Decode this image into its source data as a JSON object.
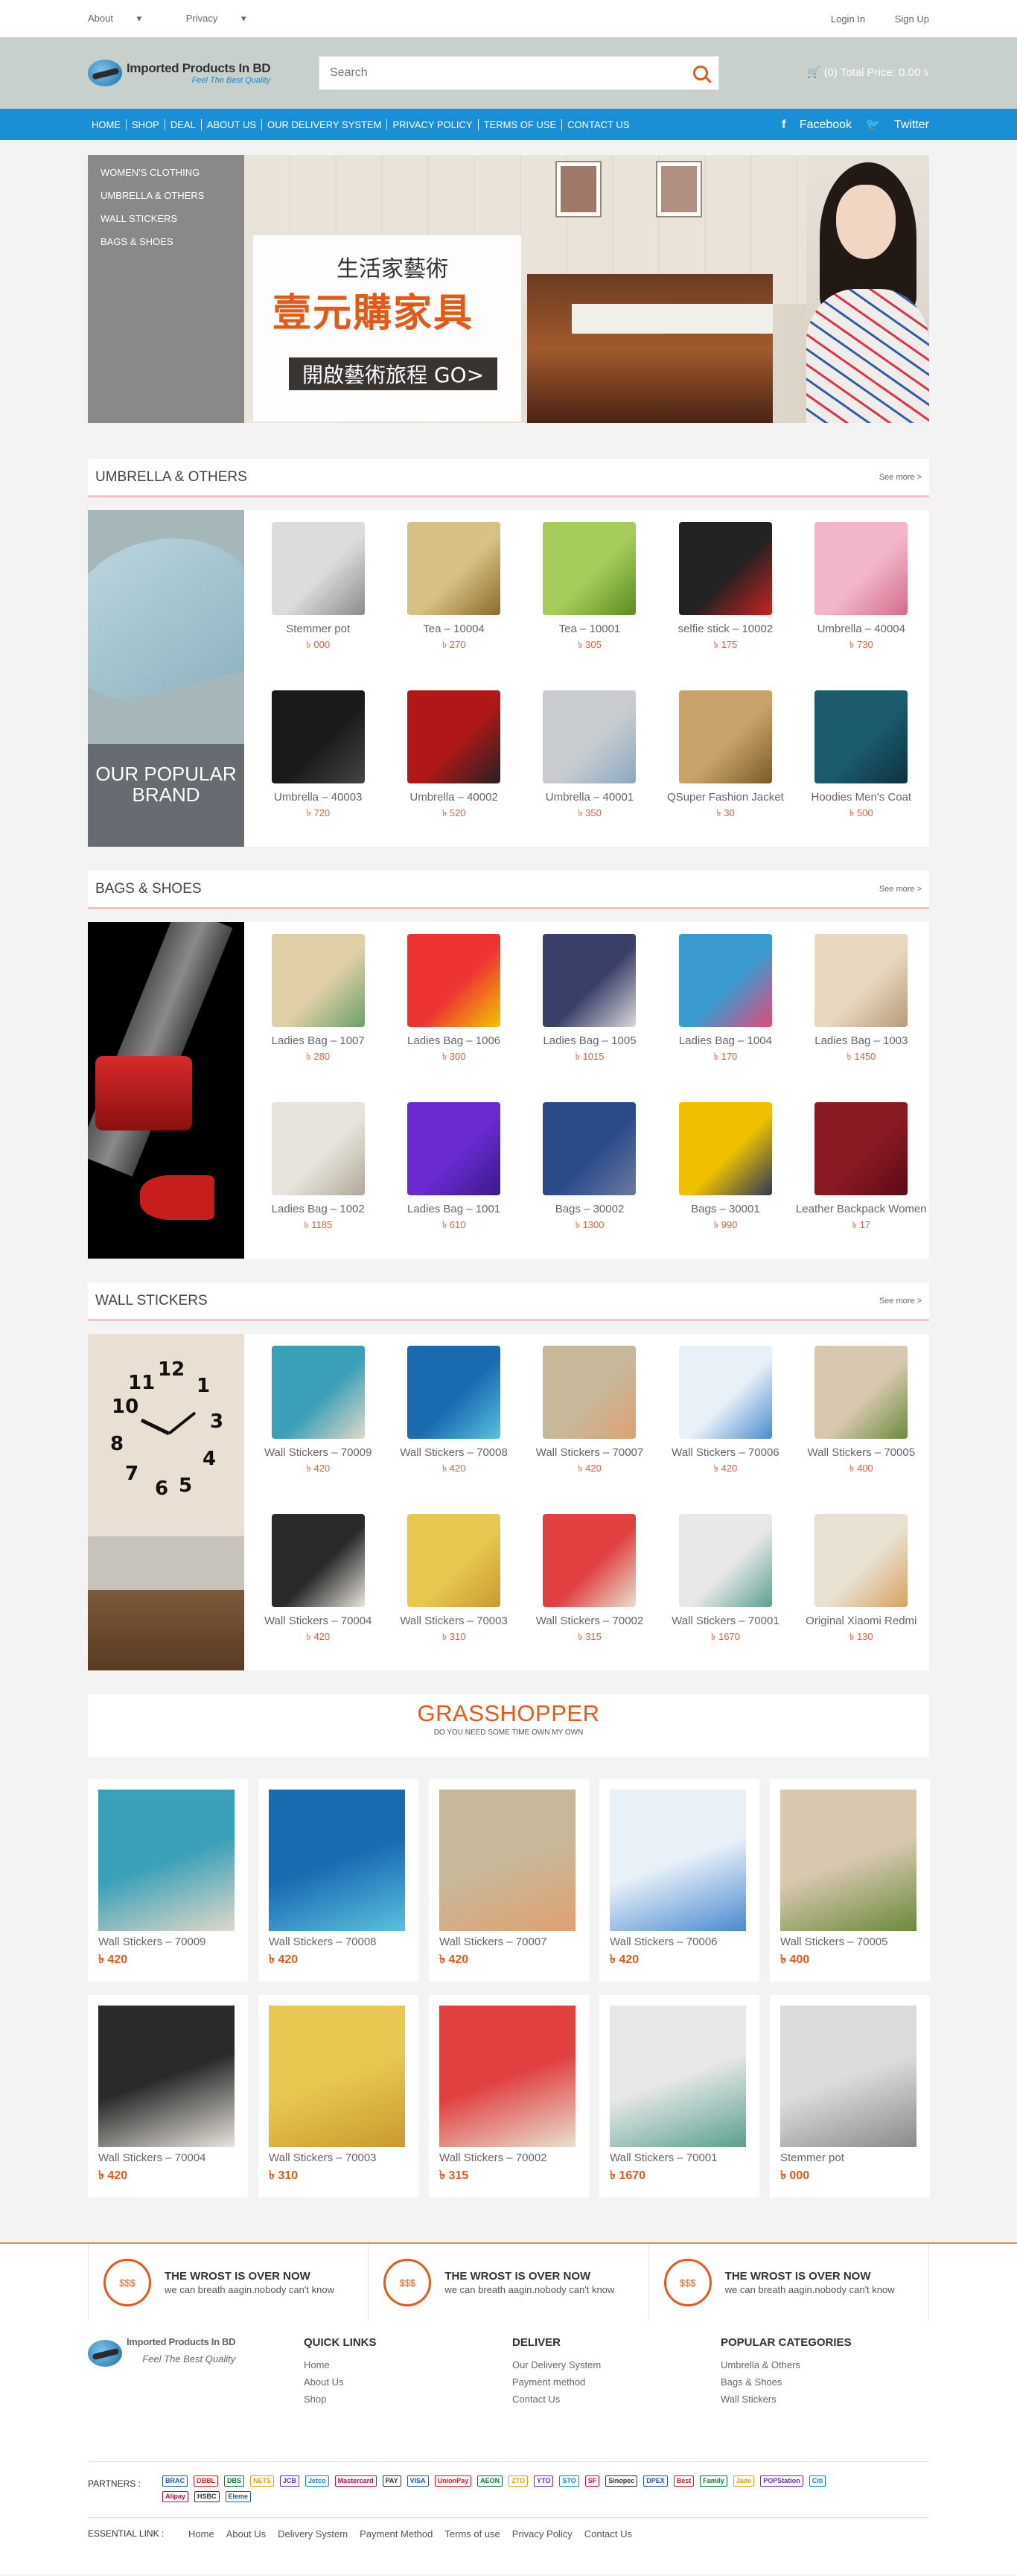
{
  "topbar": {
    "about": "About",
    "privacy": "Privacy",
    "login": "Login In",
    "signup": "Sign Up"
  },
  "header": {
    "logo_title": "Imported Products In BD",
    "logo_tagline": "Feel The Best Quality",
    "search_placeholder": "Search",
    "cart": "(0) Total Price: 0.00 ৳"
  },
  "nav": {
    "items": [
      "HOME",
      "SHOP",
      "DEAL",
      "ABOUT US",
      "OUR DELIVERY SYSTEM",
      "PRIVACY POLICY",
      "TERMS OF USE",
      "CONTACT US"
    ],
    "facebook": "Facebook",
    "twitter": "Twitter"
  },
  "sidebar": {
    "categories": [
      "WOMEN'S CLOTHING",
      "UMBRELLA & OTHERS",
      "WALL STICKERS",
      "BAGS & SHOES"
    ]
  },
  "banner": {
    "line1": "生活家藝術",
    "line2": "壹元購家具",
    "cta": "開啟藝術旅程 GO>"
  },
  "sections": [
    {
      "title": "UMBRELLA & OTHERS",
      "see_more": "See more >",
      "promo_label": "OUR POPULAR BRAND",
      "items": [
        {
          "name": "Stemmer pot",
          "price": "৳ 000"
        },
        {
          "name": "Tea – 10004",
          "price": "৳ 270"
        },
        {
          "name": "Tea – 10001",
          "price": "৳ 305"
        },
        {
          "name": "selfie stick – 10002",
          "price": "৳ 175"
        },
        {
          "name": "Umbrella – 40004",
          "price": "৳ 730"
        },
        {
          "name": "Umbrella – 40003",
          "price": "৳ 720"
        },
        {
          "name": "Umbrella – 40002",
          "price": "৳ 520"
        },
        {
          "name": "Umbrella – 40001",
          "price": "৳ 350"
        },
        {
          "name": "QSuper Fashion Jacket",
          "price": "৳ 30"
        },
        {
          "name": "Hoodies Men's Coat",
          "price": "৳ 500"
        }
      ]
    },
    {
      "title": "BAGS & SHOES",
      "see_more": "See more >",
      "items": [
        {
          "name": "Ladies Bag – 1007",
          "price": "৳ 280"
        },
        {
          "name": "Ladies Bag – 1006",
          "price": "৳ 300"
        },
        {
          "name": "Ladies Bag – 1005",
          "price": "৳ 1015"
        },
        {
          "name": "Ladies Bag – 1004",
          "price": "৳ 170"
        },
        {
          "name": "Ladies Bag – 1003",
          "price": "৳ 1450"
        },
        {
          "name": "Ladies Bag – 1002",
          "price": "৳ 1185"
        },
        {
          "name": "Ladies Bag – 1001",
          "price": "৳ 610"
        },
        {
          "name": "Bags – 30002",
          "price": "৳ 1300"
        },
        {
          "name": "Bags – 30001",
          "price": "৳ 990"
        },
        {
          "name": "Leather Backpack Women",
          "price": "৳ 17"
        }
      ]
    },
    {
      "title": "WALL STICKERS",
      "see_more": "See more >",
      "items": [
        {
          "name": "Wall Stickers – 70009",
          "price": "৳ 420"
        },
        {
          "name": "Wall Stickers – 70008",
          "price": "৳ 420"
        },
        {
          "name": "Wall Stickers – 70007",
          "price": "৳ 420"
        },
        {
          "name": "Wall Stickers – 70006",
          "price": "৳ 420"
        },
        {
          "name": "Wall Stickers – 70005",
          "price": "৳ 400"
        },
        {
          "name": "Wall Stickers – 70004",
          "price": "৳ 420"
        },
        {
          "name": "Wall Stickers – 70003",
          "price": "৳ 310"
        },
        {
          "name": "Wall Stickers – 70002",
          "price": "৳ 315"
        },
        {
          "name": "Wall Stickers – 70001",
          "price": "৳ 1670"
        },
        {
          "name": "Original Xiaomi Redmi",
          "price": "৳ 130"
        }
      ]
    }
  ],
  "grasshopper": {
    "title": "GRASSHOPPER",
    "subtitle": "DO YOU NEED SOME TIME OWN MY OWN",
    "cards": [
      {
        "name": "Wall Stickers – 70009",
        "price": "৳ 420"
      },
      {
        "name": "Wall Stickers – 70008",
        "price": "৳ 420"
      },
      {
        "name": "Wall Stickers – 70007",
        "price": "৳ 420"
      },
      {
        "name": "Wall Stickers – 70006",
        "price": "৳ 420"
      },
      {
        "name": "Wall Stickers – 70005",
        "price": "৳ 400"
      },
      {
        "name": "Wall Stickers – 70004",
        "price": "৳ 420"
      },
      {
        "name": "Wall Stickers – 70003",
        "price": "৳ 310"
      },
      {
        "name": "Wall Stickers – 70002",
        "price": "৳ 315"
      },
      {
        "name": "Wall Stickers – 70001",
        "price": "৳ 1670"
      },
      {
        "name": "Stemmer pot",
        "price": "৳ 000"
      }
    ]
  },
  "features": [
    {
      "icon": "$$$",
      "title": "THE WROST IS OVER NOW",
      "text": "we can breath aagin.nobody can't know"
    },
    {
      "icon": "$$$",
      "title": "THE WROST IS OVER NOW",
      "text": "we can breath aagin.nobody can't know"
    },
    {
      "icon": "$$$",
      "title": "THE WROST IS OVER NOW",
      "text": "we can breath aagin.nobody can't know"
    }
  ],
  "footer": {
    "quick_links": {
      "title": "QUICK LINKS",
      "items": [
        "Home",
        "About Us",
        "Shop"
      ]
    },
    "deliver": {
      "title": "DELIVER",
      "items": [
        "Our Delivery System",
        "Payment method",
        "Contact Us"
      ]
    },
    "popular": {
      "title": "POPULAR CATEGORIES",
      "items": [
        "Umbrella & Others",
        "Bags & Shoes",
        "Wall Stickers"
      ]
    },
    "partners_label": "PARTNERS :",
    "partners": [
      "BRAC",
      "DBBL",
      "DBS",
      "NETS",
      "JCB",
      "Jetco",
      "Mastercard",
      "PAY",
      "VISA",
      "UnionPay",
      "AEON",
      "ZTO",
      "YTO",
      "STO",
      "SF",
      "Sinopec",
      "DPEX",
      "Best",
      "Family",
      "Jade",
      "POPStation",
      "Citi",
      "Alipay",
      "HSBC",
      "Eleme"
    ],
    "essential_label": "ESSENTIAL LINK :",
    "essential": [
      "Home",
      "About Us",
      "Delivery System",
      "Payment Method",
      "Terms of use",
      "Privacy Policy",
      "Contact Us"
    ]
  }
}
